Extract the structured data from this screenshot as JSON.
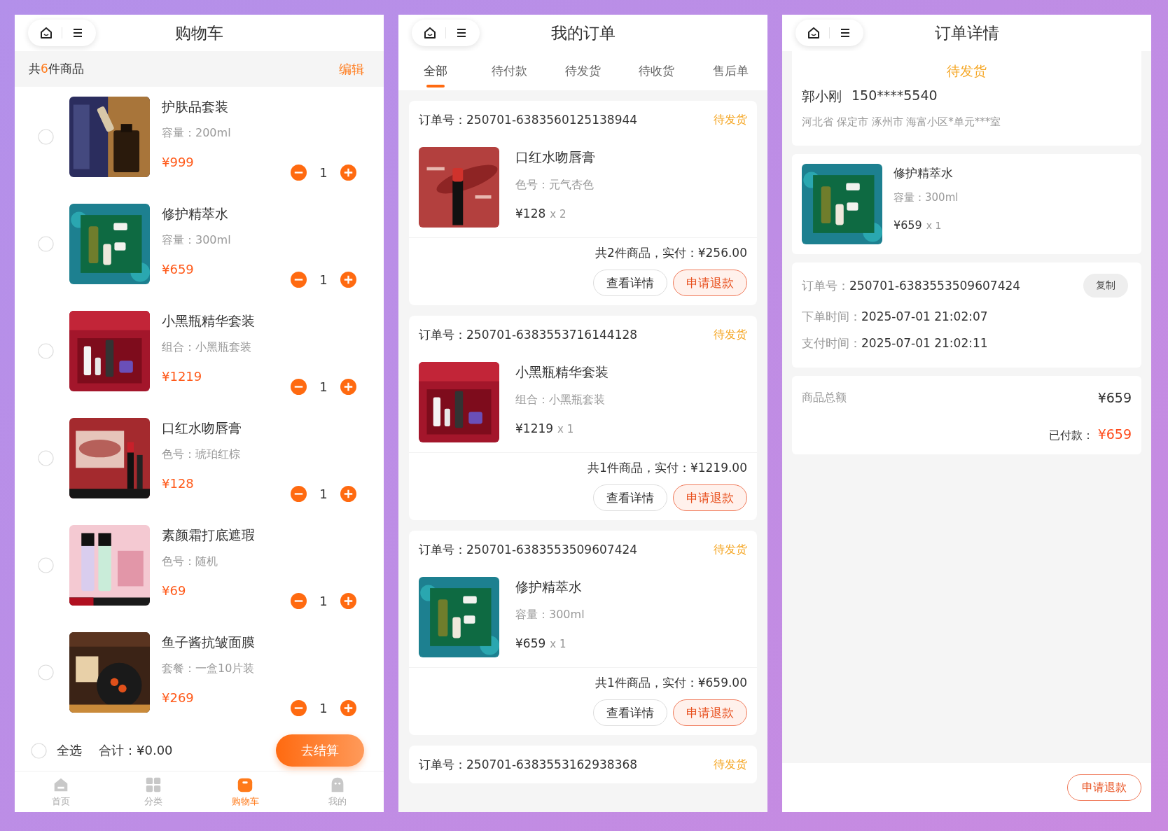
{
  "cart_screen": {
    "title": "购物车",
    "summary": "共**6**件商品",
    "edit": "编辑",
    "items": [
      {
        "name": "护肤品套装",
        "spec": "容量：200ml",
        "price": "¥999",
        "quantity": "1",
        "selected": false
      },
      {
        "name": "修护精萃水",
        "spec": "容量：300ml",
        "price": "¥659",
        "quantity": "1",
        "selected": false
      },
      {
        "name": "小黑瓶精华套装",
        "spec": "组合：小黑瓶套装",
        "price": "¥1219",
        "quantity": "1",
        "selected": false
      },
      {
        "name": "口红水吻唇膏",
        "spec": "色号：琥珀红棕",
        "price": "¥128",
        "quantity": "1",
        "selected": false
      },
      {
        "name": "素颜霜打底遮瑕",
        "spec": "色号：随机",
        "price": "¥69",
        "quantity": "1",
        "selected": false
      },
      {
        "name": "鱼子酱抗皱面膜",
        "spec": "套餐：一盒10片装",
        "price": "¥269",
        "quantity": "1",
        "selected": false
      }
    ],
    "footer": {
      "select_all": "全选",
      "select_all_selected": false,
      "total": "合计：¥0.00",
      "checkout": "去结算"
    },
    "tab_bar": [
      {
        "label": "首页",
        "kind": "home",
        "selected": false
      },
      {
        "label": "分类",
        "kind": "grid",
        "selected": false
      },
      {
        "label": "购物车",
        "kind": "bag",
        "selected": true
      },
      {
        "label": "我的",
        "kind": "person",
        "selected": false
      }
    ]
  },
  "orders_screen": {
    "title": "我的订单",
    "tabs": [
      {
        "label": "全部",
        "selected": true
      },
      {
        "label": "待付款",
        "selected": false
      },
      {
        "label": "待发货",
        "selected": false
      },
      {
        "label": "待收货",
        "selected": false
      },
      {
        "label": "售后单",
        "selected": false
      }
    ],
    "orders": [
      {
        "order_no": "订单号：250701-6383560125138944",
        "status": "待发货",
        "items": [
          {
            "name": "口红水吻唇膏",
            "spec": "色号：元气杏色",
            "price": "¥128",
            "quantity": "x 2"
          }
        ],
        "summary": "共2件商品，实付：¥256.00",
        "buttons": [
          {
            "label": "查看详情",
            "kind": "outline"
          },
          {
            "label": "申请退款",
            "kind": "refund"
          }
        ]
      },
      {
        "order_no": "订单号：250701-6383553716144128",
        "status": "待发货",
        "items": [
          {
            "name": "小黑瓶精华套装",
            "spec": "组合：小黑瓶套装",
            "price": "¥1219",
            "quantity": "x 1"
          }
        ],
        "summary": "共1件商品，实付：¥1219.00",
        "buttons": [
          {
            "label": "查看详情",
            "kind": "outline"
          },
          {
            "label": "申请退款",
            "kind": "refund"
          }
        ]
      },
      {
        "order_no": "订单号：250701-6383553509607424",
        "status": "待发货",
        "items": [
          {
            "name": "修护精萃水",
            "spec": "容量：300ml",
            "price": "¥659",
            "quantity": "x 1"
          }
        ],
        "summary": "共1件商品，实付：¥659.00",
        "buttons": [
          {
            "label": "查看详情",
            "kind": "outline"
          },
          {
            "label": "申请退款",
            "kind": "refund"
          }
        ]
      },
      {
        "order_no": "订单号：250701-6383553162938368",
        "status": "待发货"
      }
    ]
  },
  "detail_screen": {
    "title": "订单详情",
    "status": "待发货",
    "receiver": "郭小刚",
    "phone": "150****5540",
    "address": "河北省 保定市 涿州市 海富小区*单元***室",
    "item": {
      "name": "修护精萃水",
      "spec": "容量：300ml",
      "price": "¥659",
      "quantity": "x 1"
    },
    "info": [
      {
        "label": "订单号：",
        "value": "250701-6383553509607424",
        "action": "复制"
      },
      {
        "label": "下单时间：",
        "value": "2025-07-01 21:02:07"
      },
      {
        "label": "支付时间：",
        "value": "2025-07-01 21:02:11"
      }
    ],
    "goods_total_label": "商品总额",
    "goods_total": "¥659",
    "paid_label": "已付款：",
    "paid": "¥659",
    "refund_button": "申请退款"
  }
}
